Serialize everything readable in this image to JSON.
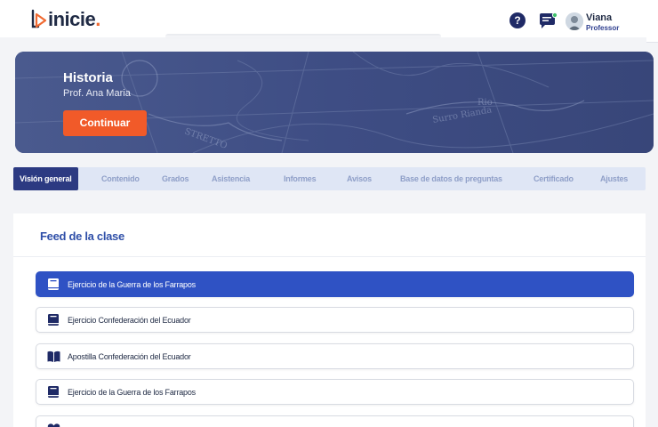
{
  "header": {
    "logo_text": "inicie",
    "logo_dot": ".",
    "help_icon": "question-circle-icon",
    "chat_icon": "chat-bubble-icon",
    "user": {
      "name": "Viana",
      "role": "Professor"
    }
  },
  "banner": {
    "title": "Historia",
    "subtitle": "Prof. Ana Maria",
    "button_label": "Continuar"
  },
  "tabs": [
    {
      "label": "Visión general",
      "active": true
    },
    {
      "label": "Contenido",
      "active": false
    },
    {
      "label": "Grados",
      "active": false
    },
    {
      "label": "Asistencia",
      "active": false
    },
    {
      "label": "Informes",
      "active": false
    },
    {
      "label": "Avisos",
      "active": false
    },
    {
      "label": "Base de datos de preguntas",
      "active": false
    },
    {
      "label": "Certificado",
      "active": false
    },
    {
      "label": "Ajustes",
      "active": false
    }
  ],
  "feed": {
    "title": "Feed de la clase",
    "items": [
      {
        "label": "Ejercicio de la Guerra de los Farrapos",
        "icon": "book-icon",
        "active": true
      },
      {
        "label": "Ejercicio Confederación del Ecuador",
        "icon": "book-icon",
        "active": false
      },
      {
        "label": "Apostilla Confederación del Ecuador",
        "icon": "open-book-icon",
        "active": false
      },
      {
        "label": "Ejercicio de la Guerra de los Farrapos",
        "icon": "book-icon",
        "active": false
      }
    ]
  },
  "colors": {
    "accent": "#f15a29",
    "primary": "#2c3a82",
    "active_item": "#2f52c4",
    "tab_bar": "#dfe6f5"
  }
}
